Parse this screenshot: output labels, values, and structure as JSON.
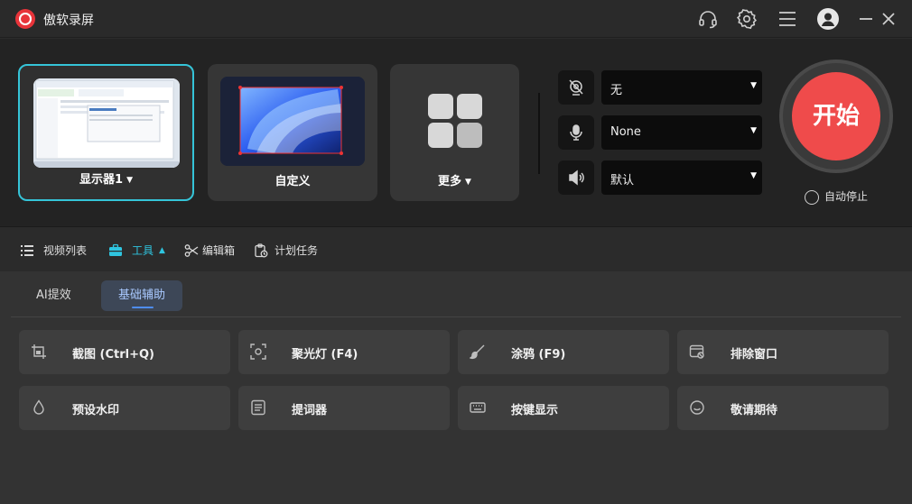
{
  "app": {
    "title": "傲软录屏"
  },
  "capture": {
    "display_label": "显示器1",
    "custom_label": "自定义",
    "more_label": "更多"
  },
  "io": {
    "camera_value": "无",
    "mic_value": "None",
    "speaker_value": "默认"
  },
  "start": {
    "label": "开始",
    "auto_stop_label": "自动停止"
  },
  "nav": {
    "video_list": "视频列表",
    "tools": "工具",
    "editor": "编辑箱",
    "schedule": "计划任务"
  },
  "tools_panel": {
    "tabs": [
      "AI提效",
      "基础辅助"
    ],
    "buttons": [
      {
        "label": "截图 (Ctrl+Q)",
        "icon": "crop-icon"
      },
      {
        "label": "聚光灯 (F4)",
        "icon": "spotlight-icon"
      },
      {
        "label": "涂鸦 (F9)",
        "icon": "brush-icon"
      },
      {
        "label": "排除窗口",
        "icon": "exclude-window-icon"
      },
      {
        "label": "预设水印",
        "icon": "watermark-drop-icon"
      },
      {
        "label": "提词器",
        "icon": "teleprompter-icon"
      },
      {
        "label": "按键显示",
        "icon": "keyboard-icon"
      },
      {
        "label": "敬请期待",
        "icon": "smile-icon"
      }
    ]
  },
  "colors": {
    "accent": "#35c4d8",
    "start_red": "#ef4b4b",
    "active_tab_text": "#a9c9ff"
  }
}
